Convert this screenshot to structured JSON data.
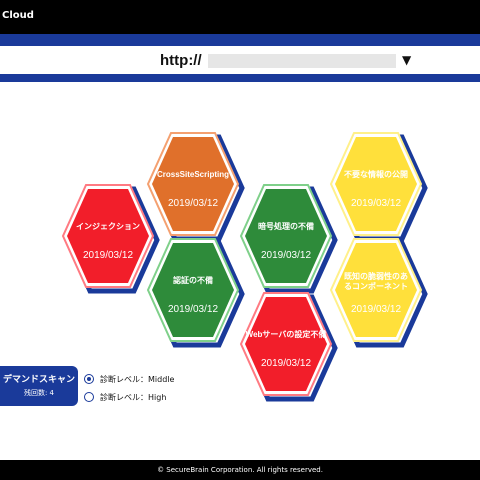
{
  "app": {
    "title": "Cloud"
  },
  "url_bar": {
    "prefix": "http://",
    "value": "",
    "dropdown_icon": "triangle-down-icon"
  },
  "hexes": [
    {
      "label": "CrossSiteScripting",
      "date": "2019/03/12",
      "status": "orange",
      "color": "#e0702b"
    },
    {
      "label": "インジェクション",
      "date": "2019/03/12",
      "status": "red",
      "color": "#f21e2a"
    },
    {
      "label": "暗号処理の不備",
      "date": "2019/03/12",
      "status": "green",
      "color": "#2e8b3a"
    },
    {
      "label": "不要な情報の公開",
      "date": "2019/03/12",
      "status": "yellow",
      "color": "#ffe03b"
    },
    {
      "label": "認証の不備",
      "date": "2019/03/12",
      "status": "green",
      "color": "#2e8b3a"
    },
    {
      "label": "既知の脆弱性のあるコンポーネント",
      "date": "2019/03/12",
      "status": "yellow",
      "color": "#ffe03b"
    },
    {
      "label": "Webサーバの設定不備",
      "date": "2019/03/12",
      "status": "red",
      "color": "#f21e2a"
    }
  ],
  "scan": {
    "title": "デマンドスキャン",
    "remaining": "残回数: 4"
  },
  "diagnosis_levels": [
    {
      "label": "診断レベル：Middle",
      "checked": true
    },
    {
      "label": "診断レベル：High",
      "checked": false
    }
  ],
  "footer": {
    "text": "© SecureBrain Corporation. All rights reserved."
  },
  "colors": {
    "accent": "#1a3a9a",
    "background": "#000000"
  }
}
